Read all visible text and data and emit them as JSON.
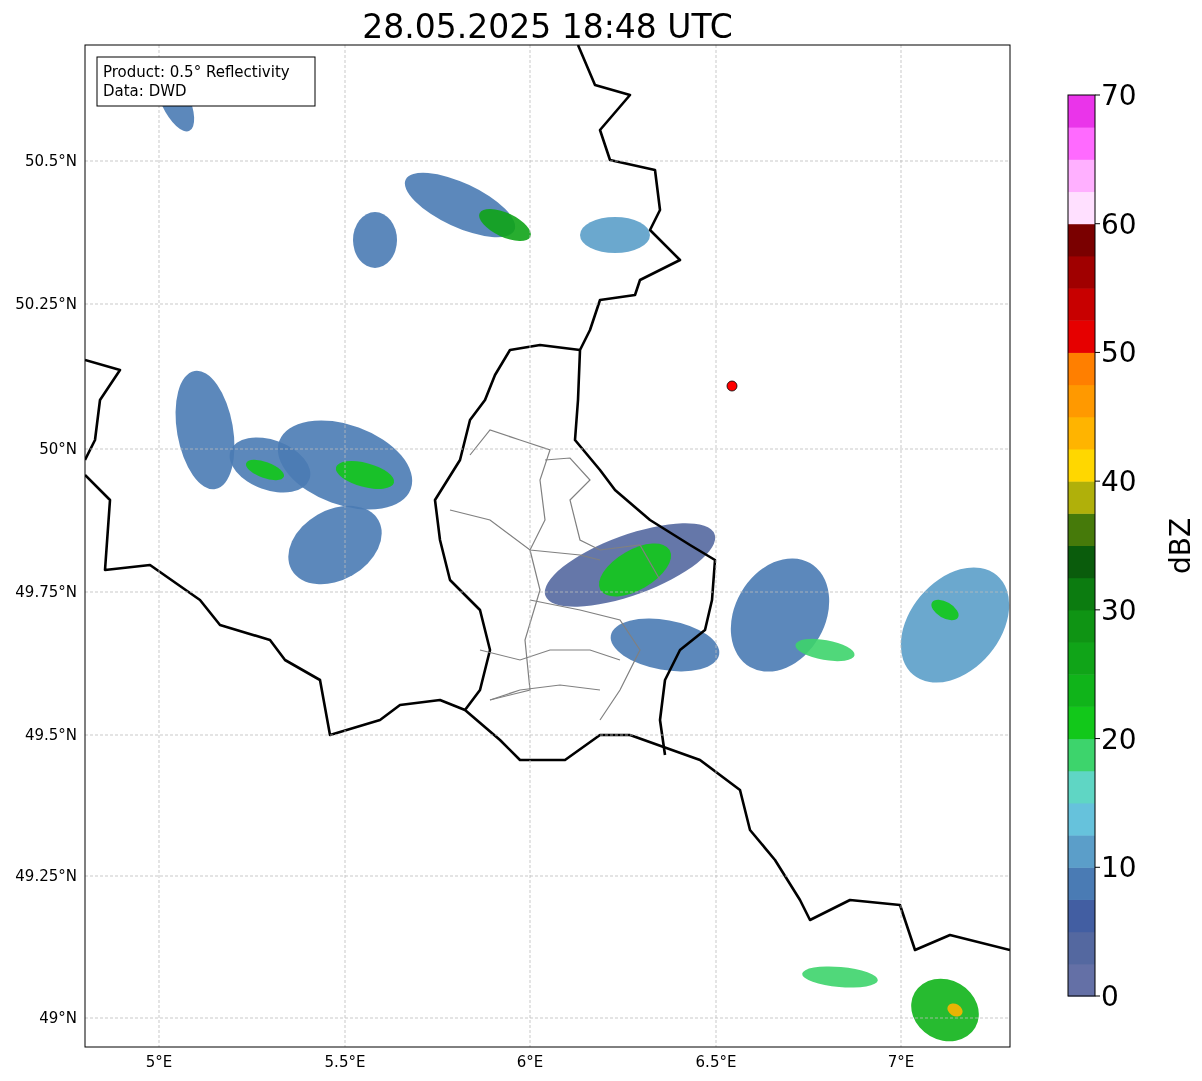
{
  "title": "28.05.2025 18:48 UTC",
  "legend": {
    "lines": [
      "Product: 0.5° Reflectivity",
      "Data: DWD"
    ]
  },
  "map": {
    "x_ticks": [
      "5°E",
      "5.5°E",
      "6°E",
      "6.5°E",
      "7°E"
    ],
    "y_ticks": [
      "50.5°N",
      "50.25°N",
      "50°N",
      "49.75°N",
      "49.5°N",
      "49.25°N",
      "49°N"
    ]
  },
  "colorbar": {
    "label": "dBZ",
    "ticks": [
      "70",
      "60",
      "50",
      "40",
      "30",
      "20",
      "10",
      "0"
    ],
    "colors": [
      {
        "color": "#6470a6"
      },
      {
        "color": "#5468a0"
      },
      {
        "color": "#425ea2"
      },
      {
        "color": "#4a7bb4"
      },
      {
        "color": "#5b9ec9"
      },
      {
        "color": "#66c2dc"
      },
      {
        "color": "#5fd6c4"
      },
      {
        "color": "#3dd46c"
      },
      {
        "color": "#12c81a"
      },
      {
        "color": "#10b41a"
      },
      {
        "color": "#10a418"
      },
      {
        "color": "#0f9414"
      },
      {
        "color": "#0c7c10"
      },
      {
        "color": "#0a5c0c"
      },
      {
        "color": "#467a0a"
      },
      {
        "color": "#b0b00a"
      },
      {
        "color": "#ffd700"
      },
      {
        "color": "#ffb400"
      },
      {
        "color": "#ff9900"
      },
      {
        "color": "#ff7f00"
      },
      {
        "color": "#e60000"
      },
      {
        "color": "#c80000"
      },
      {
        "color": "#a00000"
      },
      {
        "color": "#7a0000"
      },
      {
        "color": "#ffe0ff"
      },
      {
        "color": "#ffb0ff"
      },
      {
        "color": "#ff6aff"
      },
      {
        "color": "#ea34ea"
      }
    ]
  }
}
